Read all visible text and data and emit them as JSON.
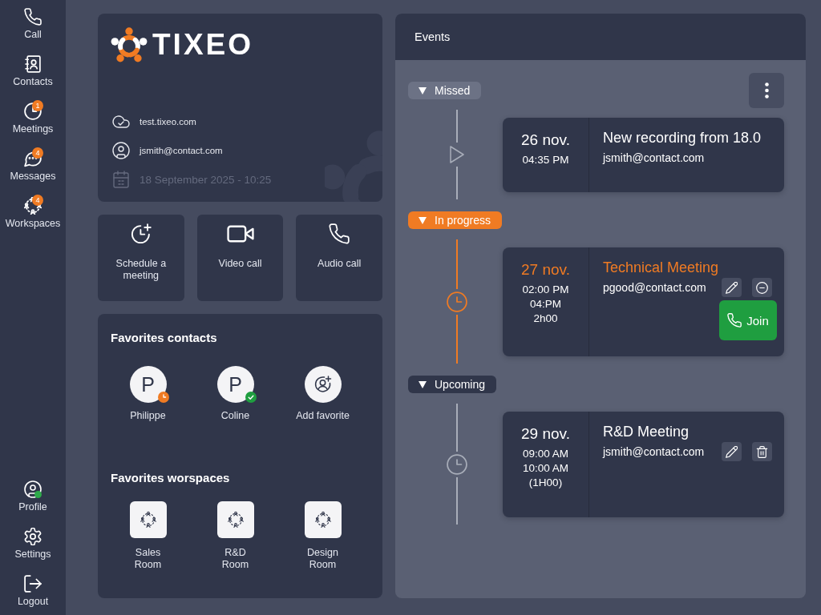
{
  "sidebar": {
    "items": [
      {
        "label": "Call",
        "selected": false
      },
      {
        "label": "Contacts",
        "selected": false
      },
      {
        "label": "Meetings",
        "badge": "1",
        "selected": false
      },
      {
        "label": "Messages",
        "badge": "4",
        "selected": false
      },
      {
        "label": "Workspaces",
        "badge": "4",
        "selected": false
      }
    ],
    "bottom_items": [
      {
        "label": "Profile",
        "online": true,
        "selected": false
      },
      {
        "label": "Settings",
        "selected": false
      },
      {
        "label": "Logout",
        "selected": false
      }
    ]
  },
  "profile_card": {
    "brand": "TIXEO",
    "server": "test.tixeo.com",
    "account": "jsmith@contact.com",
    "datetime": "18 September 2025 - 10:25"
  },
  "quick_actions": [
    {
      "label": "Schedule a meeting"
    },
    {
      "label": "Video call"
    },
    {
      "label": "Audio call"
    }
  ],
  "favorites": {
    "contacts_title": "Favorites contacts",
    "contacts": [
      {
        "kind": "contact",
        "initial": "P",
        "name": "Philippe",
        "available": false
      },
      {
        "kind": "contact",
        "initial": "P",
        "name": "Coline",
        "available": true
      },
      {
        "kind": "add",
        "name": "Add favorite"
      }
    ],
    "workspaces_title": "Favorites worspaces",
    "workspaces": [
      {
        "name": "Sales Room"
      },
      {
        "name": "R&D Room"
      },
      {
        "name": "Design Room"
      }
    ]
  },
  "events": {
    "title": "Events",
    "sections": [
      {
        "kind": "missed",
        "label": "Missed",
        "expanded": true,
        "items": [
          {
            "kind": "recording",
            "date": "26 nov.",
            "times": [
              "04:35 PM"
            ],
            "title": "New recording from 18.0",
            "contact": "jsmith@contact.com"
          }
        ]
      },
      {
        "kind": "in_progress",
        "label": "In progress",
        "expanded": true,
        "items": [
          {
            "kind": "meeting",
            "date": "27 nov.",
            "times": [
              "02:00 PM",
              "04:PM",
              "2h00"
            ],
            "title": "Technical Meeting",
            "contact": "pgood@contact.com",
            "actions": [
              {
                "kind": "edit"
              },
              {
                "kind": "remove"
              }
            ],
            "join": "Join"
          }
        ]
      },
      {
        "kind": "upcoming",
        "label": "Upcoming",
        "expanded": true,
        "items": [
          {
            "kind": "meeting",
            "date": "29 nov.",
            "times": [
              "09:00 AM",
              "10:00 AM",
              "(1H00)"
            ],
            "title": "R&D Meeting",
            "contact": "jsmith@contact.com",
            "actions": [
              {
                "kind": "edit"
              },
              {
                "kind": "delete"
              }
            ]
          }
        ]
      }
    ]
  }
}
